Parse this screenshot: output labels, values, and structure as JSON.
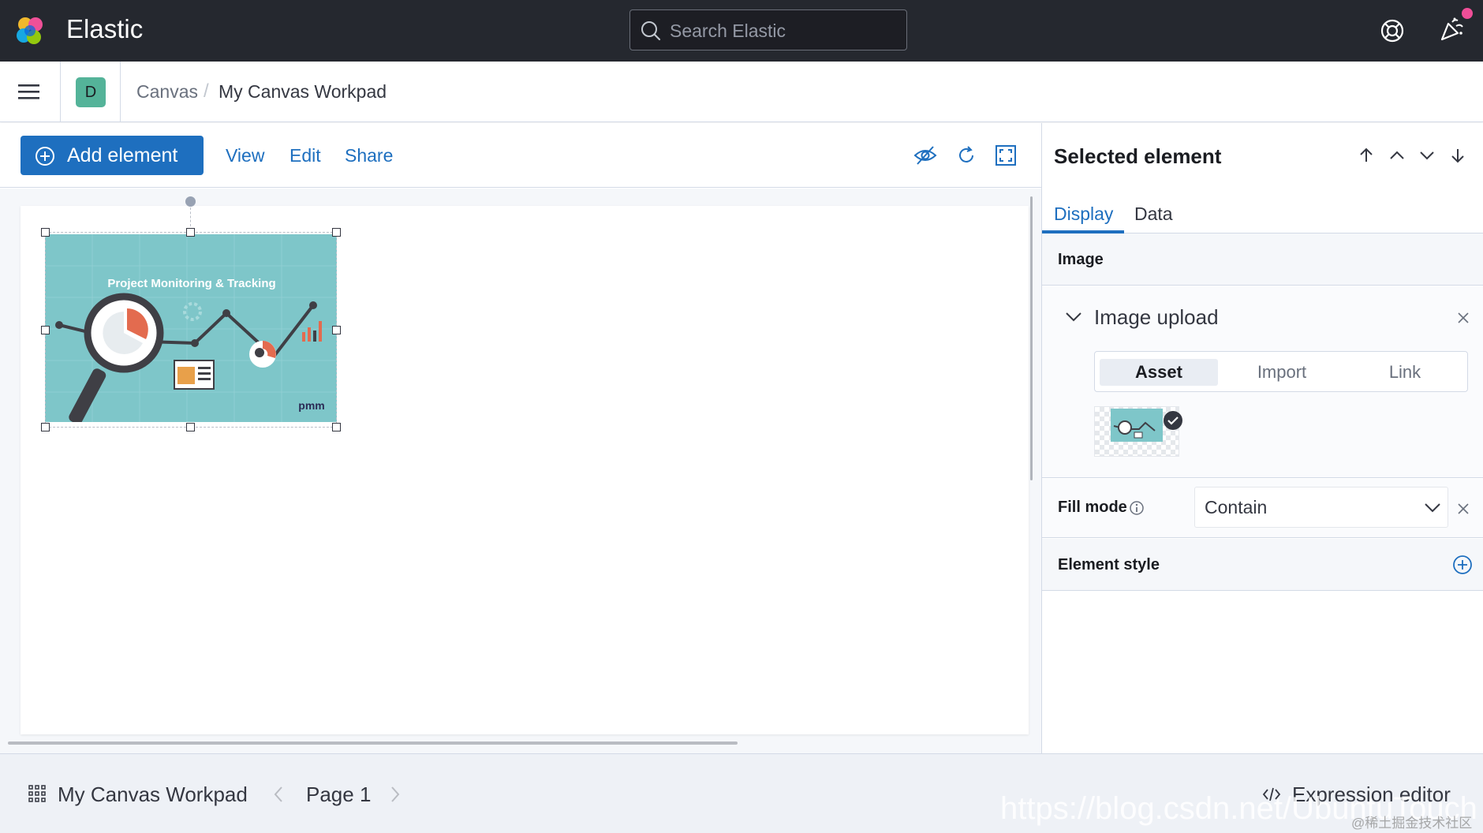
{
  "header": {
    "brand": "Elastic",
    "search_placeholder": "Search Elastic",
    "help_icon": "help-icon",
    "news_icon": "newsfeed-icon",
    "colors": {
      "header_bg": "#25282f",
      "news_badge": "#f04e98"
    }
  },
  "breadcrumbs": {
    "space_initial": "D",
    "items": [
      "Canvas",
      "My Canvas Workpad"
    ],
    "separator": "/"
  },
  "toolbar": {
    "add_element": "Add element",
    "links": [
      "View",
      "Edit",
      "Share"
    ],
    "icons": [
      "hide-editing-controls-icon",
      "refresh-icon",
      "fullscreen-icon"
    ],
    "colors": {
      "primary": "#1e6fbf"
    }
  },
  "canvas": {
    "image": {
      "title": "Project Monitoring & Tracking",
      "logo_text": "pmm",
      "colors": {
        "teal": "#7ec6c9",
        "dark": "#3f3f45",
        "accent": "#e36b4f"
      }
    }
  },
  "sidebar": {
    "title": "Selected element",
    "order_icons": [
      "bring-to-front-icon",
      "bring-forward-icon",
      "send-backward-icon",
      "send-to-back-icon"
    ],
    "tabs": [
      "Display",
      "Data"
    ],
    "active_tab": "Display",
    "image_section": "Image",
    "upload": {
      "title": "Image upload",
      "modes": [
        "Asset",
        "Import",
        "Link"
      ],
      "active_mode": "Asset"
    },
    "fill_mode": {
      "label": "Fill mode",
      "value": "Contain"
    },
    "element_style": "Element style"
  },
  "footer": {
    "workpad_name": "My Canvas Workpad",
    "page": "Page 1",
    "expression_editor": "Expression editor"
  },
  "watermark": {
    "url": "https://blog.csdn.net/UbuntuTouch",
    "community": "@稀土掘金技术社区"
  }
}
